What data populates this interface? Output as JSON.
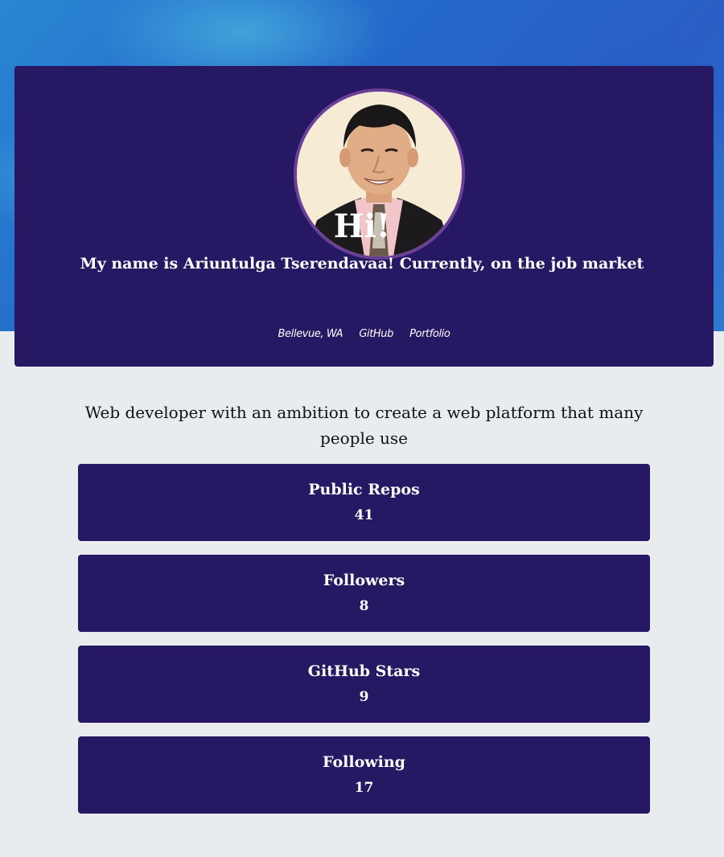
{
  "header": {
    "greeting": "Hi!",
    "intro": "My name is Ariuntulga Tserendavaa! Currently, on the job market",
    "location": "Bellevue, WA",
    "github_link": "GitHub",
    "portfolio_link": "Portfolio"
  },
  "bio": "Web developer with an ambition to create a web platform that many people use",
  "stats": [
    {
      "label": "Public Repos",
      "value": "41"
    },
    {
      "label": "Followers",
      "value": "8"
    },
    {
      "label": "GitHub Stars",
      "value": "9"
    },
    {
      "label": "Following",
      "value": "17"
    }
  ],
  "colors": {
    "card": "#261862",
    "avatar_ring": "#6a3f97",
    "page_background": "#e8ecee",
    "hero_blue": "#2466c9"
  }
}
